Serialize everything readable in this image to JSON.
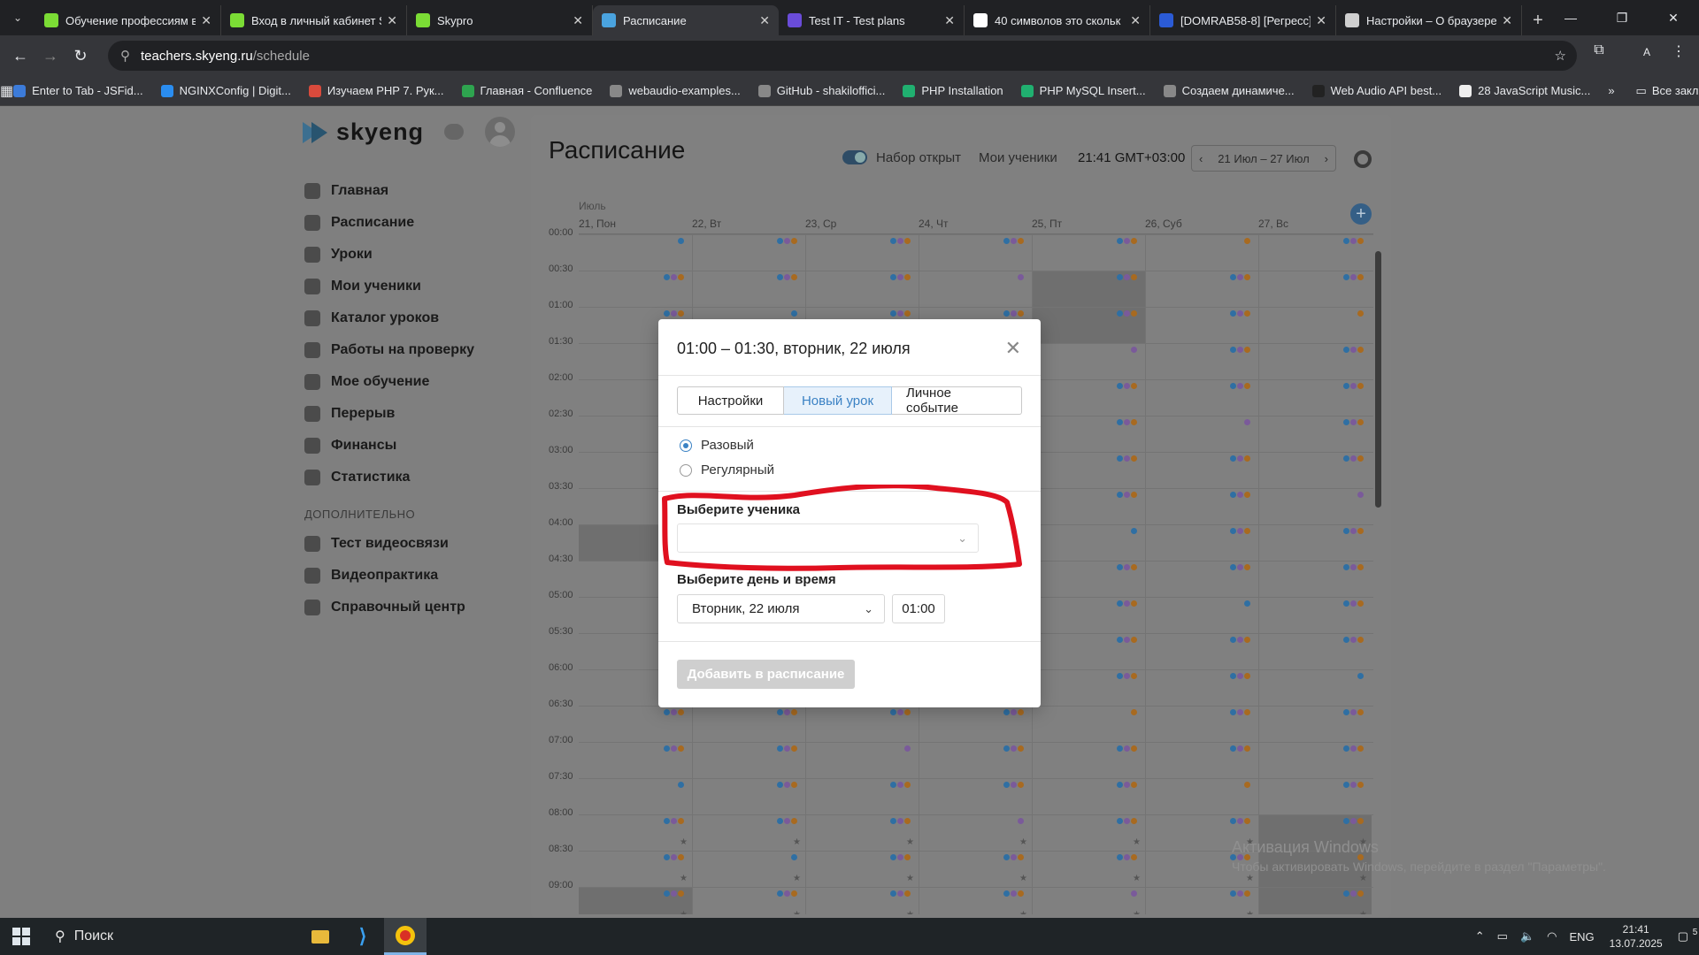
{
  "browser": {
    "tabs": [
      {
        "title": "Обучение профессиям в",
        "icon": "skypro-icon",
        "color": "#7bdc35"
      },
      {
        "title": "Вход в личный кабинет S",
        "icon": "skypro-icon",
        "color": "#7bdc35"
      },
      {
        "title": "Skypro",
        "icon": "skypro-icon",
        "color": "#7bdc35"
      },
      {
        "title": "Расписание",
        "icon": "skyeng-icon",
        "color": "#4aa3df"
      },
      {
        "title": "Test IT - Test plans",
        "icon": "testit-icon",
        "color": "#6a4cd9"
      },
      {
        "title": "40 символов это скольк",
        "icon": "google-icon",
        "color": "#ffffff"
      },
      {
        "title": "[DOMRAB58-8] [Регресс]",
        "icon": "jira-icon",
        "color": "#2b5bd6"
      },
      {
        "title": "Настройки – О браузере",
        "icon": "settings-icon",
        "color": "#cfcfcf"
      }
    ],
    "url_domain": "teachers.skyeng.ru",
    "url_path": "/schedule",
    "profile_letter": "A",
    "bookmarks": [
      "Enter to Tab - JSFid...",
      "NGINXConfig | Digit...",
      "Изучаем PHP 7. Рук...",
      "Главная - Confluence",
      "webaudio-examples...",
      "GitHub - shakiloffici...",
      "PHP Installation",
      "PHP MySQL Insert...",
      "Создаем динамиче...",
      "Web Audio API best...",
      "28 JavaScript Music..."
    ],
    "all_bookmarks": "Все закладки"
  },
  "sidebar": {
    "logo": "skyeng",
    "menu": [
      "Главная",
      "Расписание",
      "Уроки",
      "Мои ученики",
      "Каталог уроков",
      "Работы на проверку",
      "Мое обучение",
      "Перерыв",
      "Финансы",
      "Статистика"
    ],
    "section": "ДОПОЛНИТЕЛЬНО",
    "extra": [
      "Тест видеосвязи",
      "Видеопрактика",
      "Справочный центр"
    ]
  },
  "header": {
    "title": "Расписание",
    "recruit": "Набор открыт",
    "students": "Мои ученики",
    "time": "21:41 GMT+03:00",
    "week": "21 Июл – 27 Июл"
  },
  "calendar": {
    "month": "Июль",
    "days": [
      "21, Пон",
      "22, Вт",
      "23, Ср",
      "24, Чт",
      "25, Пт",
      "26, Суб",
      "27, Вс"
    ],
    "times": [
      "00:00",
      "00:30",
      "01:00",
      "01:30",
      "02:00",
      "02:30",
      "03:00",
      "03:30",
      "04:00",
      "04:30",
      "05:00",
      "05:30",
      "06:00",
      "06:30",
      "07:00",
      "07:30",
      "08:00",
      "08:30",
      "09:00"
    ],
    "dot_colors": [
      "#2f6fa3",
      "#7a5a9a",
      "#a86a20"
    ]
  },
  "modal": {
    "title": "01:00 – 01:30, вторник, 22 июля",
    "tabs": [
      "Настройки",
      "Новый урок",
      "Личное событие"
    ],
    "selected_tab": "Новый урок",
    "radio_once": "Разовый",
    "radio_regular": "Регулярный",
    "student_label": "Выберите ученика",
    "student_value": "",
    "datetime_label": "Выберите день и время",
    "day_value": "Вторник, 22 июля",
    "time_value": "01:00",
    "submit": "Добавить в расписание"
  },
  "watermark": {
    "line1": "Активация Windows",
    "line2": "Чтобы активировать Windows, перейдите в раздел \"Параметры\"."
  },
  "taskbar": {
    "search": "Поиск",
    "lang": "ENG",
    "time": "21:41",
    "date": "13.07.2025",
    "notif_count": "5"
  }
}
